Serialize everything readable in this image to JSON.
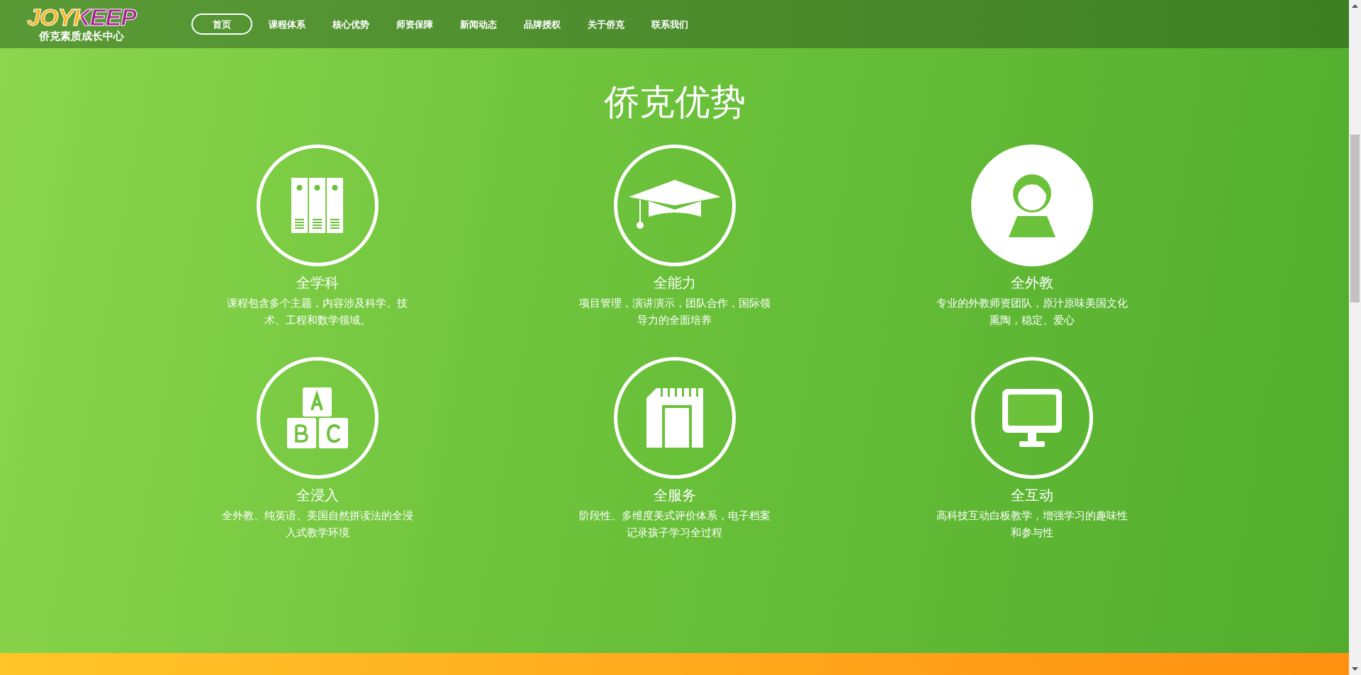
{
  "header": {
    "logo": {
      "word": "JOYKEEP",
      "tagline": "侨克素质成长中心"
    },
    "nav": [
      {
        "label": "首页",
        "selected": true
      },
      {
        "label": "课程体系",
        "selected": false
      },
      {
        "label": "核心优势",
        "selected": false
      },
      {
        "label": "师资保障",
        "selected": false
      },
      {
        "label": "新闻动态",
        "selected": false
      },
      {
        "label": "品牌授权",
        "selected": false
      },
      {
        "label": "关于侨克",
        "selected": false
      },
      {
        "label": "联系我们",
        "selected": false
      }
    ]
  },
  "section": {
    "title": "侨克优势",
    "features": [
      {
        "title": "全学科",
        "description": "课程包含多个主题，内容涉及科学、技术、工程和数学领域。",
        "highlighted": false
      },
      {
        "title": "全能力",
        "description": "项目管理，演讲演示，团队合作，国际领导力的全面培养",
        "highlighted": false
      },
      {
        "title": "全外教",
        "description": "专业的外教师资团队，原汁原味美国文化熏陶，稳定、爱心",
        "highlighted": true
      },
      {
        "title": "全浸入",
        "description": "全外教、纯英语、美国自然拼读法的全浸入式教学环境",
        "highlighted": false
      },
      {
        "title": "全服务",
        "description": "阶段性、多维度美式评价体系，电子档案记录孩子学习全过程",
        "highlighted": false
      },
      {
        "title": "全互动",
        "description": "高科技互动白板教学，增强学习的趣味性和参与性",
        "highlighted": false
      }
    ]
  }
}
